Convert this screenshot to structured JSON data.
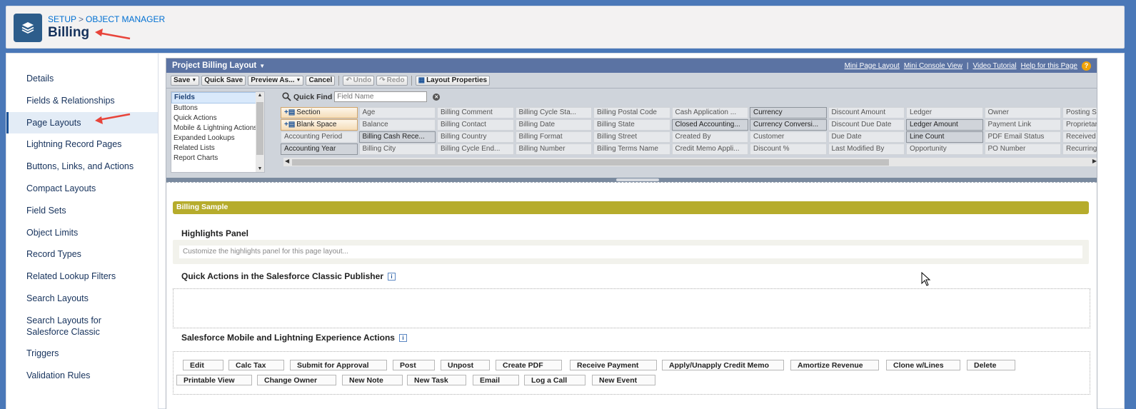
{
  "header": {
    "breadcrumb": [
      "SETUP",
      ">",
      "OBJECT MANAGER"
    ],
    "title": "Billing"
  },
  "sidebar": {
    "items": [
      {
        "label": "Details"
      },
      {
        "label": "Fields & Relationships"
      },
      {
        "label": "Page Layouts",
        "active": true
      },
      {
        "label": "Lightning Record Pages"
      },
      {
        "label": "Buttons, Links, and Actions"
      },
      {
        "label": "Compact Layouts"
      },
      {
        "label": "Field Sets"
      },
      {
        "label": "Object Limits"
      },
      {
        "label": "Record Types"
      },
      {
        "label": "Related Lookup Filters"
      },
      {
        "label": "Search Layouts"
      },
      {
        "label": "Search Layouts for Salesforce Classic"
      },
      {
        "label": "Triggers"
      },
      {
        "label": "Validation Rules"
      }
    ]
  },
  "editor": {
    "layout_name": "Project Billing Layout",
    "links": [
      "Mini Page Layout",
      "Mini Console View",
      "|",
      "Video Tutorial",
      "Help for this Page"
    ],
    "help_glyph": "?",
    "toolbar": {
      "save": "Save",
      "quick_save": "Quick Save",
      "preview": "Preview As...",
      "cancel": "Cancel",
      "undo": "Undo",
      "redo": "Redo",
      "layout_properties": "Layout Properties"
    },
    "categories": [
      "Fields",
      "Buttons",
      "Quick Actions",
      "Mobile & Lightning Actions",
      "Expanded Lookups",
      "Related Lists",
      "Report Charts"
    ],
    "quick_find_label": "Quick Find",
    "quick_find_placeholder": "Field Name",
    "fields": [
      [
        {
          "label": "Section",
          "kind": "special"
        },
        {
          "label": "Age"
        },
        {
          "label": "Billing Comment"
        },
        {
          "label": "Billing Cycle Sta..."
        },
        {
          "label": "Billing Postal Code"
        },
        {
          "label": "Cash Application ..."
        },
        {
          "label": "Currency",
          "kind": "used"
        },
        {
          "label": "Discount Amount"
        },
        {
          "label": "Ledger"
        },
        {
          "label": "Owner"
        },
        {
          "label": "Posting St"
        }
      ],
      [
        {
          "label": "Blank Space",
          "kind": "special"
        },
        {
          "label": "Balance"
        },
        {
          "label": "Billing Contact"
        },
        {
          "label": "Billing Date"
        },
        {
          "label": "Billing State"
        },
        {
          "label": "Closed Accounting...",
          "kind": "used"
        },
        {
          "label": "Currency Conversi...",
          "kind": "used"
        },
        {
          "label": "Discount Due Date"
        },
        {
          "label": "Ledger Amount",
          "kind": "used"
        },
        {
          "label": "Payment Link"
        },
        {
          "label": "Proprietar"
        }
      ],
      [
        {
          "label": "Accounting Period"
        },
        {
          "label": "Billing Cash Rece...",
          "kind": "used"
        },
        {
          "label": "Billing Country"
        },
        {
          "label": "Billing Format"
        },
        {
          "label": "Billing Street"
        },
        {
          "label": "Created By"
        },
        {
          "label": "Customer"
        },
        {
          "label": "Due Date"
        },
        {
          "label": "Line Count",
          "kind": "used"
        },
        {
          "label": "PDF Email Status"
        },
        {
          "label": "Received A"
        }
      ],
      [
        {
          "label": "Accounting Year",
          "kind": "used"
        },
        {
          "label": "Billing City"
        },
        {
          "label": "Billing Cycle End..."
        },
        {
          "label": "Billing Number"
        },
        {
          "label": "Billing Terms Name"
        },
        {
          "label": "Credit Memo Appli..."
        },
        {
          "label": "Discount %"
        },
        {
          "label": "Last Modified By"
        },
        {
          "label": "Opportunity"
        },
        {
          "label": "PO Number"
        },
        {
          "label": "Recurring"
        }
      ]
    ],
    "canvas": {
      "section_title": "Billing Sample",
      "highlights_heading": "Highlights Panel",
      "highlights_placeholder": "Customize the highlights panel for this page layout...",
      "quick_actions_heading": "Quick Actions in the Salesforce Classic Publisher",
      "mobile_actions_heading": "Salesforce Mobile and Lightning Experience Actions",
      "actions_row1": [
        "Edit",
        "Calc Tax",
        "Submit for Approval",
        "Post",
        "Unpost",
        "Create PDF",
        "Receive Payment",
        "Apply/Unapply Credit Memo",
        "Amortize Revenue",
        "Clone w/Lines",
        "Delete"
      ],
      "actions_row2": [
        "Printable View",
        "Change Owner",
        "New Note",
        "New Task",
        "Email",
        "Log a Call",
        "New Event"
      ]
    }
  },
  "colors": {
    "brand_bg": "#4a78b8",
    "section_bar": "#b6ac2c",
    "editor_title": "#5b73a3",
    "annotation_arrow": "#e8443a"
  }
}
